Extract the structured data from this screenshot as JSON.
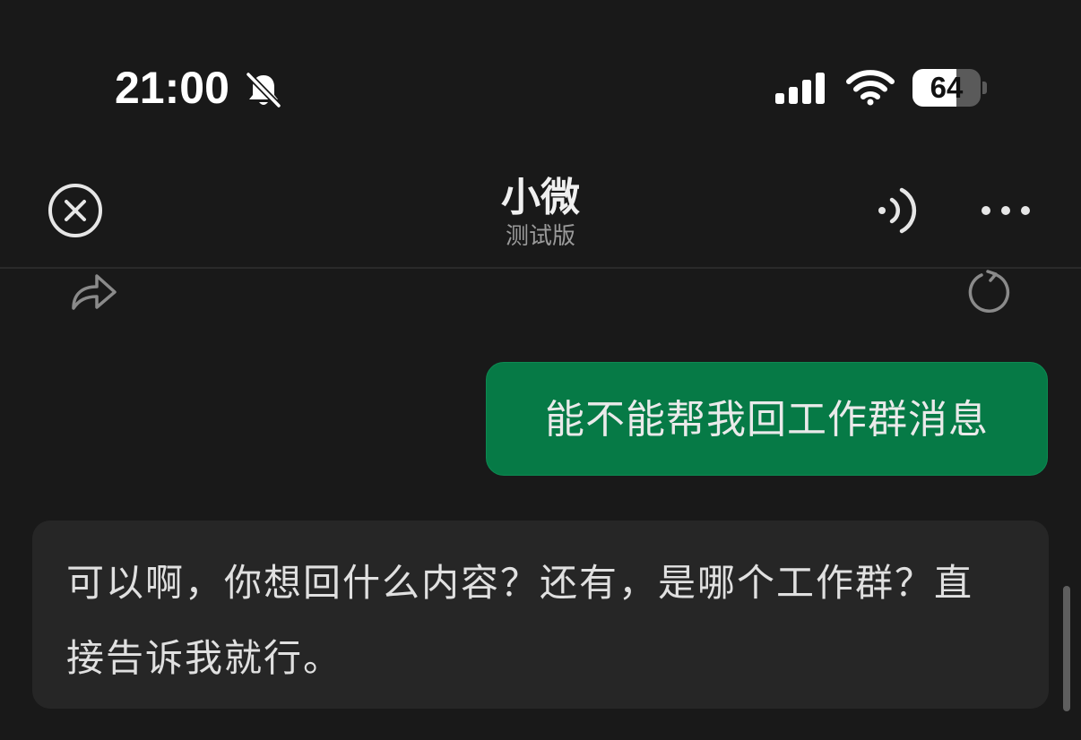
{
  "status_bar": {
    "time": "21:00",
    "battery_level": "64",
    "battery_fraction": 0.64,
    "icons": [
      "bell-slash-icon",
      "cellular-signal-icon",
      "wifi-icon",
      "battery-icon"
    ]
  },
  "nav": {
    "title": "小微",
    "subtitle": "测试版",
    "icons": [
      "close-circle-icon",
      "voice-icon",
      "more-horizontal-icon"
    ]
  },
  "toolbar": {
    "icons": [
      "share-arrow-icon",
      "refresh-icon"
    ]
  },
  "messages": [
    {
      "role": "user",
      "text": "能不能帮我回工作群消息"
    },
    {
      "role": "assistant",
      "text": "可以啊，你想回什么内容？还有，是哪个工作群？直接告诉我就行。"
    }
  ],
  "colors": {
    "background": "#191919",
    "user_bubble": "#067a46",
    "assistant_bubble": "#262626",
    "icon_gray": "#8a8a8a"
  }
}
